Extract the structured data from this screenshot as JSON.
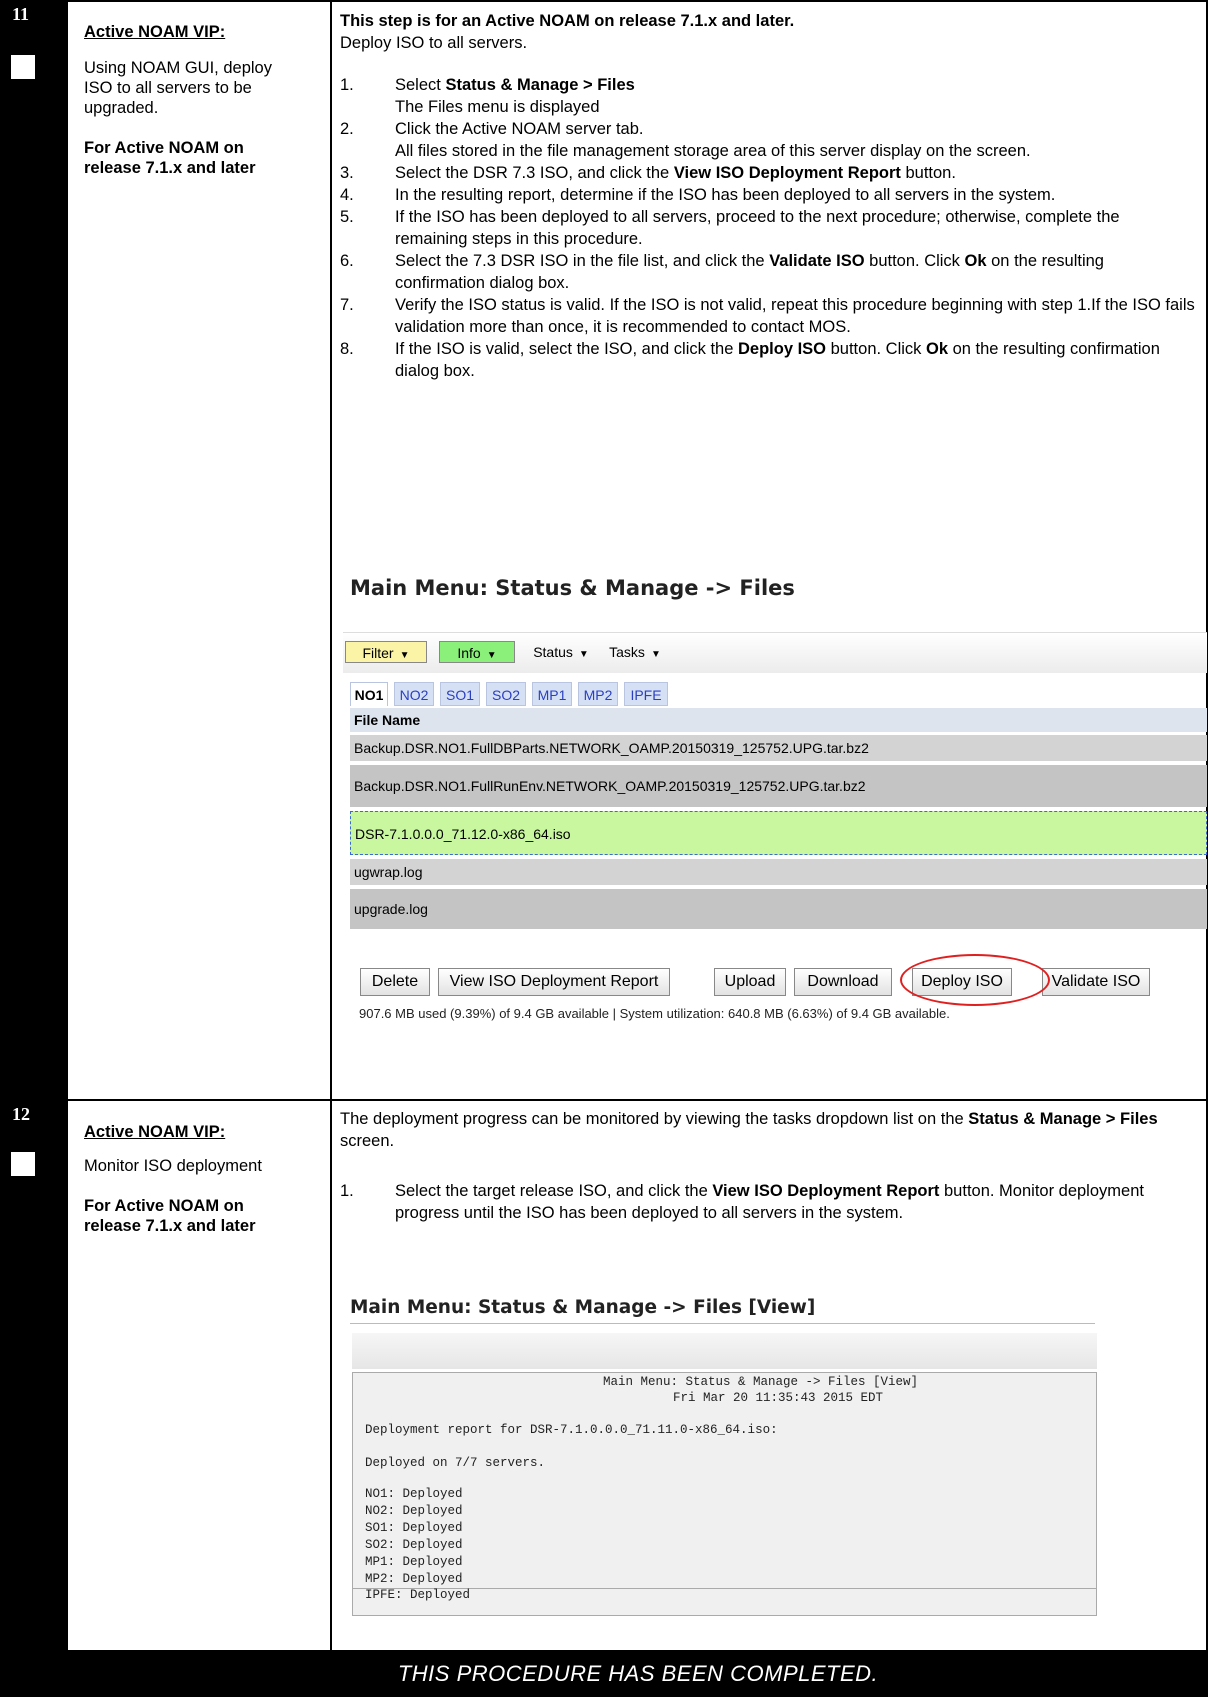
{
  "step11": {
    "number": "11",
    "title": "Active NOAM VIP:",
    "instruction": "Using NOAM GUI, deploy ISO to all servers to be upgraded.",
    "note": "For Active NOAM on release 7.1.x and later",
    "intro_bold": "This step is for an Active NOAM on release 7.1.x and later.",
    "intro": "Deploy ISO to all servers.",
    "steps": [
      {
        "n": "1.",
        "parts": [
          {
            "t": "Select "
          },
          {
            "b": "Status & Manage > Files"
          }
        ],
        "sub": "The Files menu is displayed"
      },
      {
        "n": "2.",
        "parts": [
          {
            "t": "Click the Active NOAM server tab."
          }
        ],
        "sub": "All files stored in the file management storage area of this server display on the screen."
      },
      {
        "n": "3.",
        "parts": [
          {
            "t": "Select the DSR 7.3 ISO, and click the "
          },
          {
            "b": "View ISO Deployment Report"
          },
          {
            "t": " button."
          }
        ]
      },
      {
        "n": "4.",
        "parts": [
          {
            "t": "In the resulting report, determine if the ISO has been deployed to all servers in the system."
          }
        ]
      },
      {
        "n": "5.",
        "parts": [
          {
            "t": "If the ISO has been deployed to all servers, proceed to the next procedure; otherwise, complete the remaining steps in this procedure."
          }
        ]
      },
      {
        "n": "6.",
        "parts": [
          {
            "t": "Select the 7.3 DSR ISO in the file list, and click the "
          },
          {
            "b": "Validate ISO"
          },
          {
            "t": " button. Click "
          },
          {
            "b": "Ok"
          },
          {
            "t": " on the resulting confirmation dialog box."
          }
        ]
      },
      {
        "n": "7.",
        "parts": [
          {
            "t": "Verify the ISO status is valid. If the ISO is not valid, repeat this procedure beginning with step 1.If the ISO fails validation more than once, it is recommended to contact MOS."
          }
        ]
      },
      {
        "n": "8.",
        "parts": [
          {
            "t": "If the ISO is valid, select the ISO, and click the "
          },
          {
            "b": "Deploy ISO"
          },
          {
            "t": " button. Click "
          },
          {
            "b": "Ok"
          },
          {
            "t": " on the resulting confirmation dialog box."
          }
        ]
      }
    ],
    "screenshot": {
      "title": "Main Menu: Status & Manage -> Files",
      "toolbar": {
        "filter": "Filter",
        "info": "Info",
        "status": "Status",
        "tasks": "Tasks"
      },
      "tabs": [
        "NO1",
        "NO2",
        "SO1",
        "SO2",
        "MP1",
        "MP2",
        "IPFE"
      ],
      "active_tab": "NO1",
      "column_header": "File Name",
      "files": [
        "Backup.DSR.NO1.FullDBParts.NETWORK_OAMP.20150319_125752.UPG.tar.bz2",
        "Backup.DSR.NO1.FullRunEnv.NETWORK_OAMP.20150319_125752.UPG.tar.bz2",
        "DSR-7.1.0.0.0_71.12.0-x86_64.iso",
        "ugwrap.log",
        "upgrade.log"
      ],
      "selected_file_index": 2,
      "buttons": {
        "delete": "Delete",
        "view_report": "View ISO Deployment Report",
        "upload": "Upload",
        "download": "Download",
        "deploy": "Deploy ISO",
        "validate": "Validate ISO"
      },
      "usage": "907.6 MB used (9.39%) of 9.4 GB available | System utilization: 640.8 MB (6.63%) of 9.4 GB available."
    }
  },
  "step12": {
    "number": "12",
    "title": "Active NOAM VIP:",
    "instruction": "Monitor ISO deployment",
    "note": "For Active NOAM on release 7.1.x and later",
    "intro": "The deployment progress can be monitored by viewing the tasks dropdown list on the",
    "intro_bold": "Status & Manage > Files",
    "intro_end": " screen.",
    "step1_n": "1.",
    "step1_a": "Select the target release ISO, and click the ",
    "step1_b": "View ISO Deployment Report",
    "step1_c": " button. Monitor deployment progress until the ISO has been deployed to all servers in the system.",
    "screenshot": {
      "title": "Main Menu: Status & Manage -> Files [View]",
      "report_header": "Main Menu: Status & Manage -> Files [View]",
      "report_date": "Fri Mar 20 11:35:43 2015 EDT",
      "report_for": "Deployment report for DSR-7.1.0.0.0_71.11.0-x86_64.iso:",
      "deployed_count": "Deployed on 7/7 servers.",
      "servers": [
        "NO1: Deployed",
        "NO2: Deployed",
        "SO1: Deployed",
        "SO2: Deployed",
        "MP1: Deployed",
        "MP2: Deployed",
        "IPFE: Deployed"
      ]
    }
  },
  "footer": "THIS PROCEDURE HAS BEEN COMPLETED."
}
